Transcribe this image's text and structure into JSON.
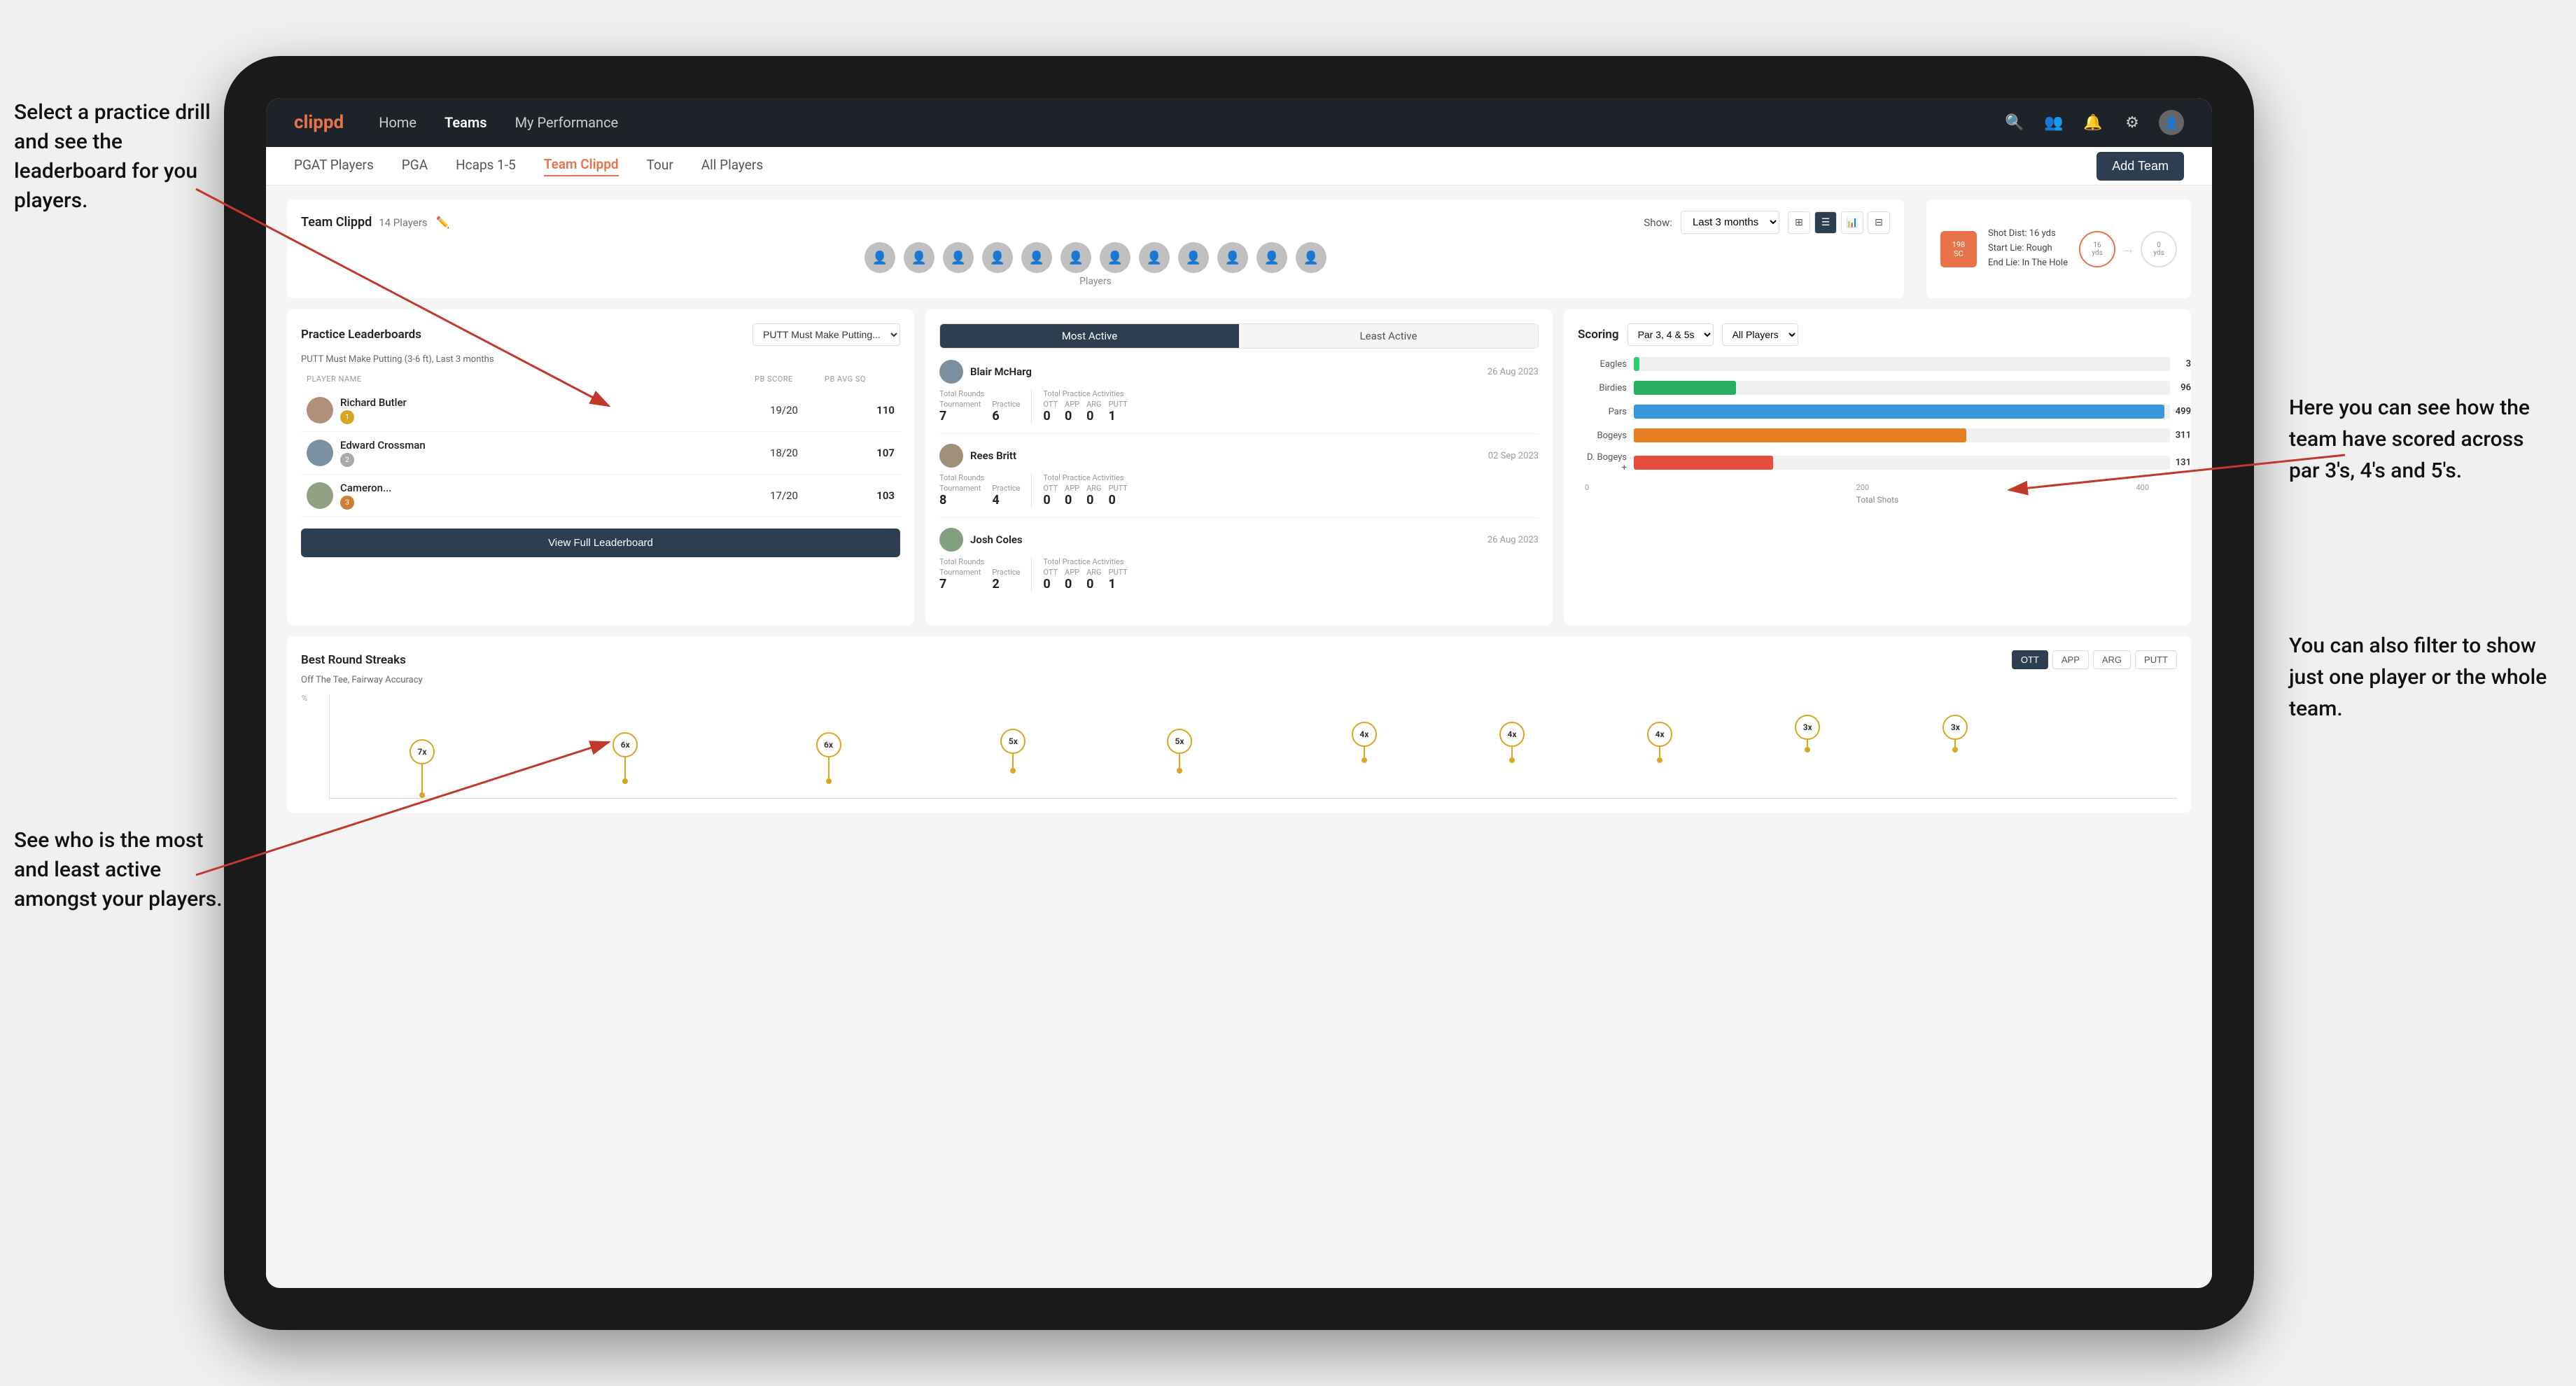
{
  "annotations": {
    "top_left": "Select a practice drill and see the leaderboard for you players.",
    "bottom_left": "See who is the most and least active amongst your players.",
    "top_right_title": "Here you can see how the team have scored across par 3's, 4's and 5's.",
    "bottom_right": "You can also filter to show just one player or the whole team."
  },
  "navbar": {
    "logo": "clippd",
    "links": [
      "Home",
      "Teams",
      "My Performance"
    ],
    "active_link": "Teams"
  },
  "sub_nav": {
    "links": [
      "PGAT Players",
      "PGA",
      "Hcaps 1-5",
      "Team Clippd",
      "Tour",
      "All Players"
    ],
    "active_link": "Team Clippd",
    "add_team_label": "Add Team"
  },
  "team_header": {
    "title": "Team Clippd",
    "player_count": "14 Players",
    "show_label": "Show:",
    "show_value": "Last 3 months",
    "players_label": "Players"
  },
  "shot_card": {
    "badge_value": "198",
    "badge_unit": "SC",
    "shot_dist_label": "Shot Dist: 16 yds",
    "start_lie_label": "Start Lie: Rough",
    "end_lie_label": "End Lie: In The Hole",
    "circle1_val": "16",
    "circle1_unit": "yds",
    "circle2_val": "0",
    "circle2_unit": "yds"
  },
  "practice_leaderboard": {
    "title": "Practice Leaderboards",
    "drill_name": "PUTT Must Make Putting...",
    "subtitle": "PUTT Must Make Putting (3-6 ft), Last 3 months",
    "headers": [
      "PLAYER NAME",
      "PB SCORE",
      "PB AVG SQ"
    ],
    "players": [
      {
        "name": "Richard Butler",
        "score": "19/20",
        "avg": "110",
        "badge": "gold",
        "badge_num": "1"
      },
      {
        "name": "Edward Crossman",
        "score": "18/20",
        "avg": "107",
        "badge": "silver",
        "badge_num": "2"
      },
      {
        "name": "Cameron...",
        "score": "17/20",
        "avg": "103",
        "badge": "bronze",
        "badge_num": "3"
      }
    ],
    "view_lb_label": "View Full Leaderboard"
  },
  "activity": {
    "tabs": [
      "Most Active",
      "Least Active"
    ],
    "active_tab": "Most Active",
    "players": [
      {
        "name": "Blair McHarg",
        "date": "26 Aug 2023",
        "total_rounds_label": "Total Rounds",
        "tournament_label": "Tournament",
        "practice_label": "Practice",
        "tournament_val": "7",
        "practice_val": "6",
        "total_practice_label": "Total Practice Activities",
        "ott_label": "OTT",
        "app_label": "APP",
        "arg_label": "ARG",
        "putt_label": "PUTT",
        "ott_val": "0",
        "app_val": "0",
        "arg_val": "0",
        "putt_val": "1"
      },
      {
        "name": "Rees Britt",
        "date": "02 Sep 2023",
        "tournament_val": "8",
        "practice_val": "4",
        "ott_val": "0",
        "app_val": "0",
        "arg_val": "0",
        "putt_val": "0"
      },
      {
        "name": "Josh Coles",
        "date": "26 Aug 2023",
        "tournament_val": "7",
        "practice_val": "2",
        "ott_val": "0",
        "app_val": "0",
        "arg_val": "0",
        "putt_val": "1"
      }
    ]
  },
  "scoring": {
    "title": "Scoring",
    "filter1": "Par 3, 4 & 5s",
    "filter2": "All Players",
    "bars": [
      {
        "label": "Eagles",
        "value": 3,
        "max": 500,
        "color": "#2ecc71"
      },
      {
        "label": "Birdies",
        "value": 96,
        "max": 500,
        "color": "#27ae60"
      },
      {
        "label": "Pars",
        "value": 499,
        "max": 500,
        "color": "#3498db"
      },
      {
        "label": "Bogeys",
        "value": 311,
        "max": 500,
        "color": "#e67e22"
      },
      {
        "label": "D. Bogeys +",
        "value": 131,
        "max": 500,
        "color": "#e74c3c"
      }
    ],
    "x_axis": [
      "0",
      "200",
      "400"
    ],
    "x_label": "Total Shots"
  },
  "streaks": {
    "title": "Best Round Streaks",
    "subtitle": "Off The Tee, Fairway Accuracy",
    "tabs": [
      "OTT",
      "APP",
      "ARG",
      "PUTT"
    ],
    "active_tab": "OTT",
    "points": [
      {
        "label": "7x",
        "left": "5%"
      },
      {
        "label": "6x",
        "left": "15%"
      },
      {
        "label": "6x",
        "left": "25%"
      },
      {
        "label": "5x",
        "left": "36%"
      },
      {
        "label": "5x",
        "left": "44%"
      },
      {
        "label": "4x",
        "left": "55%"
      },
      {
        "label": "4x",
        "left": "63%"
      },
      {
        "label": "4x",
        "left": "71%"
      },
      {
        "label": "3x",
        "left": "80%"
      },
      {
        "label": "3x",
        "left": "88%"
      }
    ]
  }
}
